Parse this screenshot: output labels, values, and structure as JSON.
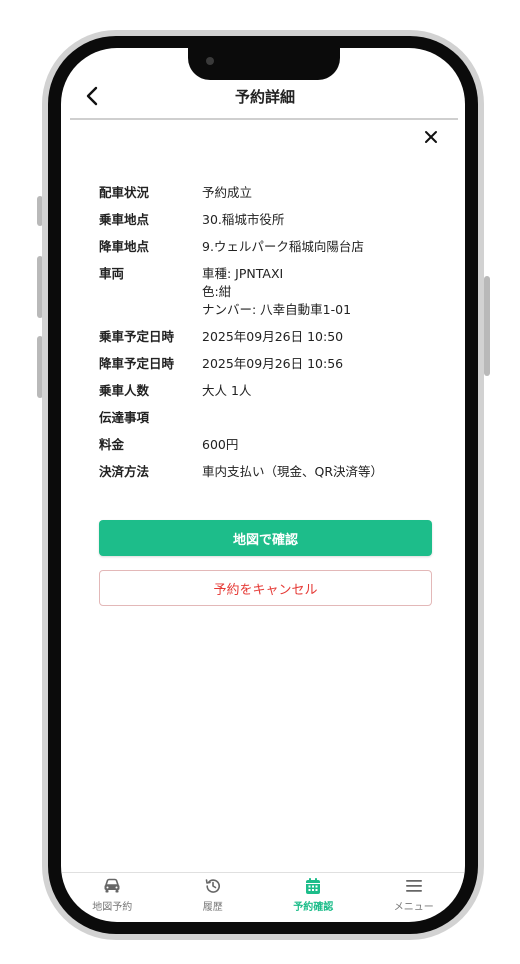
{
  "header": {
    "title": "予約詳細",
    "back_icon": "chevron-left-icon",
    "close_icon": "close-icon"
  },
  "details": [
    {
      "label": "配車状況",
      "value": [
        "予約成立"
      ]
    },
    {
      "label": "乗車地点",
      "value": [
        "30.稲城市役所"
      ]
    },
    {
      "label": "降車地点",
      "value": [
        "9.ウェルパーク稲城向陽台店"
      ]
    },
    {
      "label": "車両",
      "value": [
        "車種: JPNTAXI",
        "色:紺",
        "ナンバー: 八幸自動車1-01"
      ]
    },
    {
      "label": "乗車予定日時",
      "value": [
        "2025年09月26日 10:50"
      ]
    },
    {
      "label": "降車予定日時",
      "value": [
        "2025年09月26日 10:56"
      ]
    },
    {
      "label": "乗車人数",
      "value": [
        "大人 1人"
      ]
    },
    {
      "label": "伝達事項",
      "value": [
        ""
      ]
    },
    {
      "label": "料金",
      "value": [
        "600円"
      ]
    },
    {
      "label": "決済方法",
      "value": [
        "車内支払い（現金、QR決済等）"
      ]
    }
  ],
  "buttons": {
    "map_label": "地図で確認",
    "cancel_label": "予約をキャンセル"
  },
  "nav": [
    {
      "label": "地図予約",
      "icon": "car-icon",
      "active": false
    },
    {
      "label": "履歴",
      "icon": "history-icon",
      "active": false
    },
    {
      "label": "予約確認",
      "icon": "calendar-icon",
      "active": true
    },
    {
      "label": "メニュー",
      "icon": "menu-icon",
      "active": false
    }
  ],
  "colors": {
    "accent": "#1dbd8a",
    "danger": "#e53935"
  }
}
